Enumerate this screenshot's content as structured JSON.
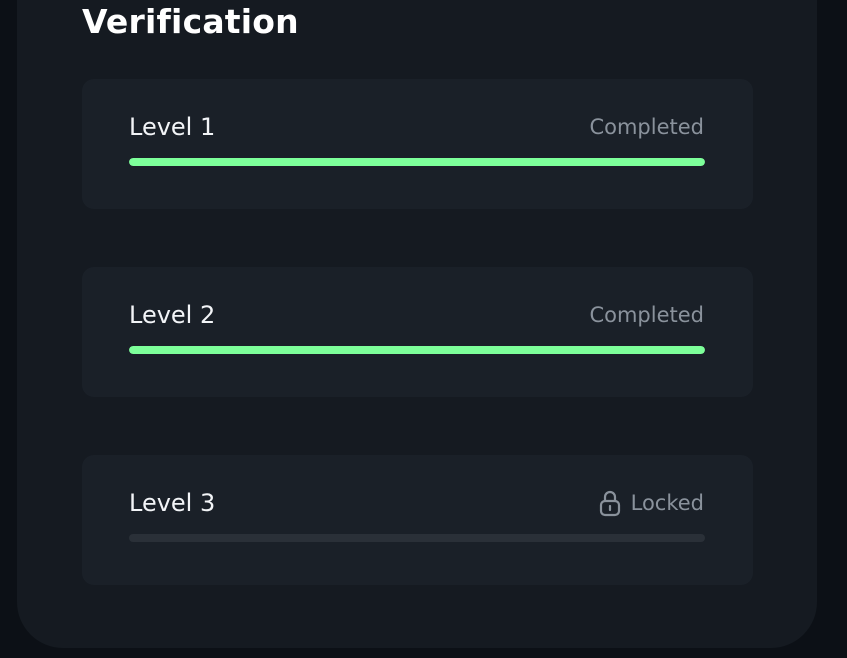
{
  "title": "Verification",
  "accent_color": "#7dff9a",
  "levels": [
    {
      "name": "Level 1",
      "status": "Completed",
      "progress": 1.0,
      "icon": ""
    },
    {
      "name": "Level 2",
      "status": "Completed",
      "progress": 1.0,
      "icon": ""
    },
    {
      "name": "Level 3",
      "status": "Locked",
      "progress": 0.0,
      "icon": "lock-icon"
    }
  ]
}
